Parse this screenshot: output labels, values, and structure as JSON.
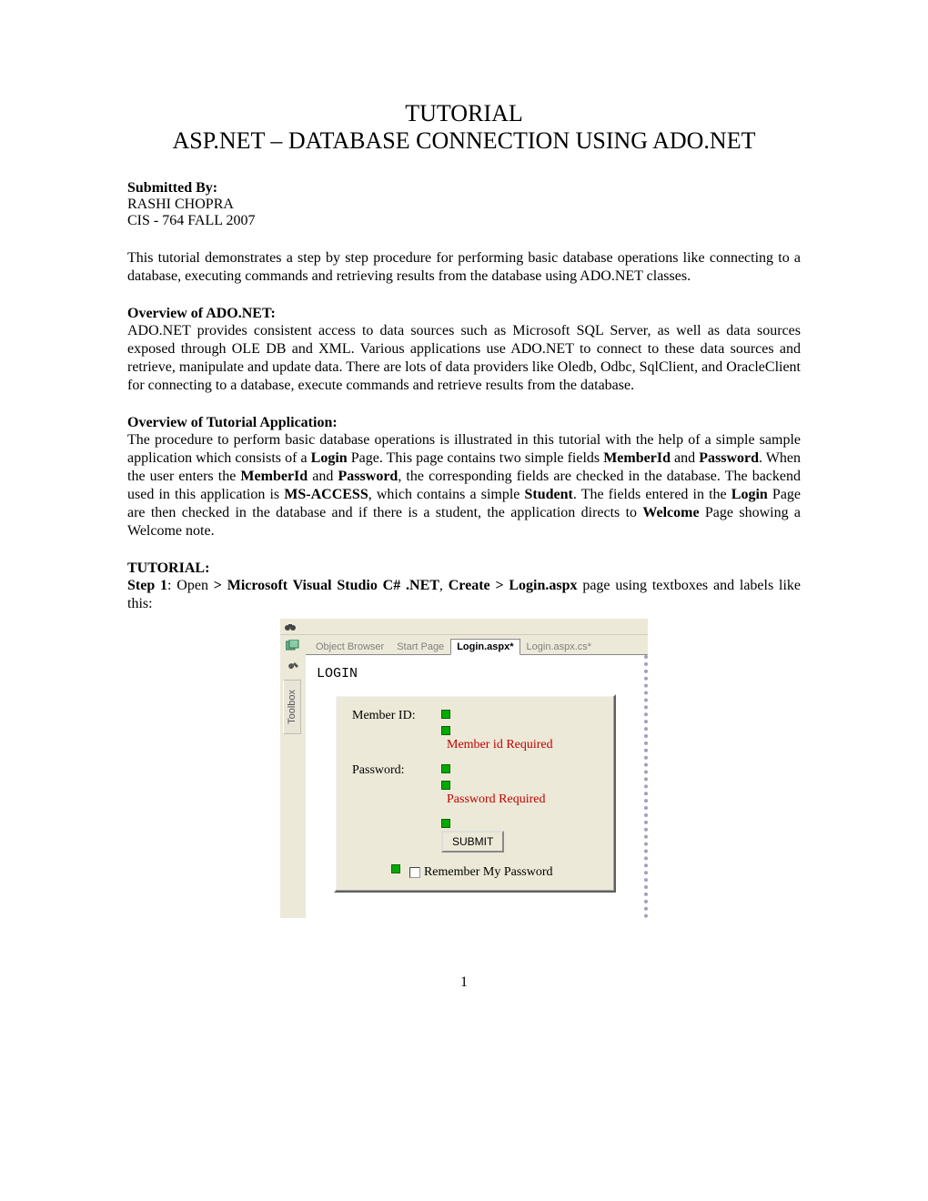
{
  "title_line1": "TUTORIAL",
  "title_line2": "ASP.NET – DATABASE CONNECTION USING ADO.NET",
  "submitted_by_label": "Submitted By:",
  "author": "RASHI CHOPRA",
  "course": "CIS - 764 FALL 2007",
  "intro": "This tutorial demonstrates a step by step procedure for performing basic database operations like connecting to a database, executing commands and retrieving results from the database using ADO.NET classes.",
  "overview_ado_heading": "Overview of ADO.NET:",
  "overview_ado_body": "ADO.NET provides consistent access to data sources such as Microsoft SQL Server, as well as data sources exposed through OLE DB and XML. Various applications use ADO.NET to connect to these data sources and retrieve, manipulate and update data. There are lots of data providers like Oledb, Odbc, SqlClient, and OracleClient for connecting to a database, execute commands and retrieve results from the database.",
  "overview_app_heading": "Overview of Tutorial Application:",
  "overview_app_body_parts": {
    "p0": "The procedure to perform basic database operations is illustrated in this tutorial with the help of a simple sample application which consists of a ",
    "b0": "Login",
    "p1": " Page. This page contains two simple fields ",
    "b1": "MemberId",
    "p2": " and ",
    "b2": "Password",
    "p3": ". When the user enters the ",
    "b3": "MemberId",
    "p4": " and ",
    "b4": "Password",
    "p5": ", the corresponding fields are checked in the database. The backend used in this application is ",
    "b5": "MS-ACCESS",
    "p6": ", which contains a simple ",
    "b6": "Student",
    "p7": ". The fields entered in the ",
    "b7": "Login",
    "p8": " Page are then checked in the database and if there is a student, the application directs to ",
    "b8": "Welcome",
    "p9": " Page showing a Welcome note."
  },
  "tutorial_heading": "TUTORIAL:",
  "step1": {
    "b0": "Step 1",
    "p0": ": Open ",
    "b1": "> Microsoft Visual Studio C# .NET",
    "p1": ", ",
    "b2": "Create > Login.aspx",
    "p2": " page using textboxes and labels like this:"
  },
  "vs": {
    "toolbox_label": "Toolbox",
    "tabs": [
      "Object Browser",
      "Start Page",
      "Login.aspx*",
      "Login.aspx.cs*"
    ],
    "active_tab_index": 2,
    "login_title": "LOGIN",
    "member_label": "Member ID:",
    "member_validator": "Member id Required",
    "password_label": "Password:",
    "password_validator": "Password Required",
    "submit_label": "SUBMIT",
    "remember_label": "Remember My Password"
  },
  "page_number": "1"
}
